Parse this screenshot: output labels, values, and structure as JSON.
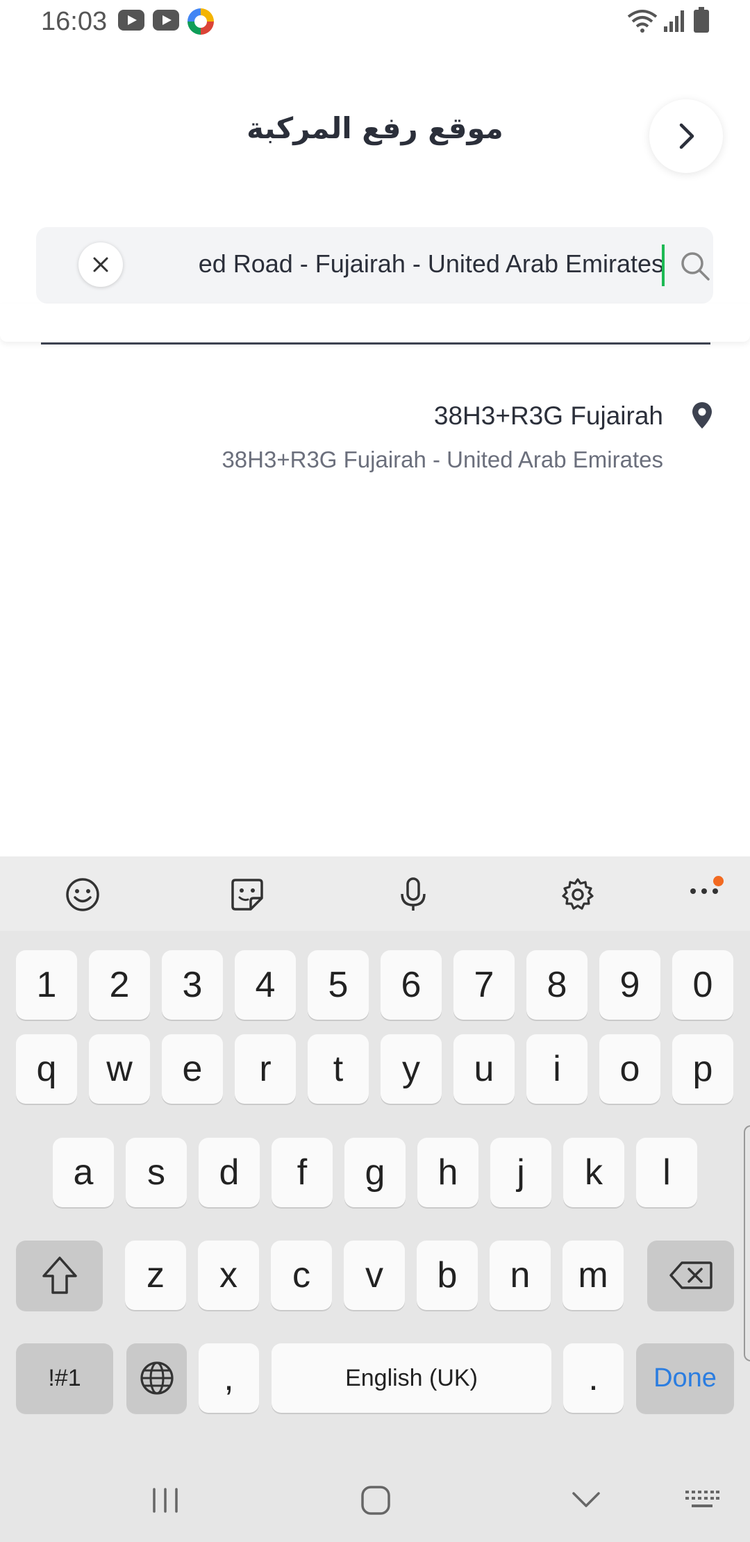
{
  "status_bar": {
    "time": "16:03",
    "left_icons": [
      "youtube-icon",
      "youtube-icon",
      "app-icon"
    ],
    "right_icons": [
      "wifi-icon",
      "signal-icon",
      "battery-icon"
    ]
  },
  "header": {
    "title": "موقع رفع المركبة",
    "back_icon": "chevron-right-icon"
  },
  "search": {
    "value": "ed Road - Fujairah - United Arab Emirates",
    "clear_icon": "close-icon",
    "search_icon": "search-icon",
    "caret_color": "#1db954"
  },
  "results": [
    {
      "title": "38H3+R3G Fujairah",
      "subtitle": "38H3+R3G Fujairah - United Arab Emirates",
      "icon": "map-pin-icon"
    }
  ],
  "keyboard": {
    "toolbar": [
      "emoji-icon",
      "sticker-icon",
      "microphone-icon",
      "settings-icon",
      "more-icon"
    ],
    "rows": {
      "numbers": [
        "1",
        "2",
        "3",
        "4",
        "5",
        "6",
        "7",
        "8",
        "9",
        "0"
      ],
      "row1": [
        "q",
        "w",
        "e",
        "r",
        "t",
        "y",
        "u",
        "i",
        "o",
        "p"
      ],
      "row2": [
        "a",
        "s",
        "d",
        "f",
        "g",
        "h",
        "j",
        "k",
        "l"
      ],
      "row3": [
        "z",
        "x",
        "c",
        "v",
        "b",
        "n",
        "m"
      ]
    },
    "symbols_label": "!#1",
    "comma_label": ",",
    "space_label": "English (UK)",
    "period_label": ".",
    "done_label": "Done",
    "accent_color": "#2b7de0"
  },
  "nav_bar": [
    "recents-icon",
    "home-icon",
    "hide-keyboard-icon",
    "keyboard-switch-icon"
  ]
}
